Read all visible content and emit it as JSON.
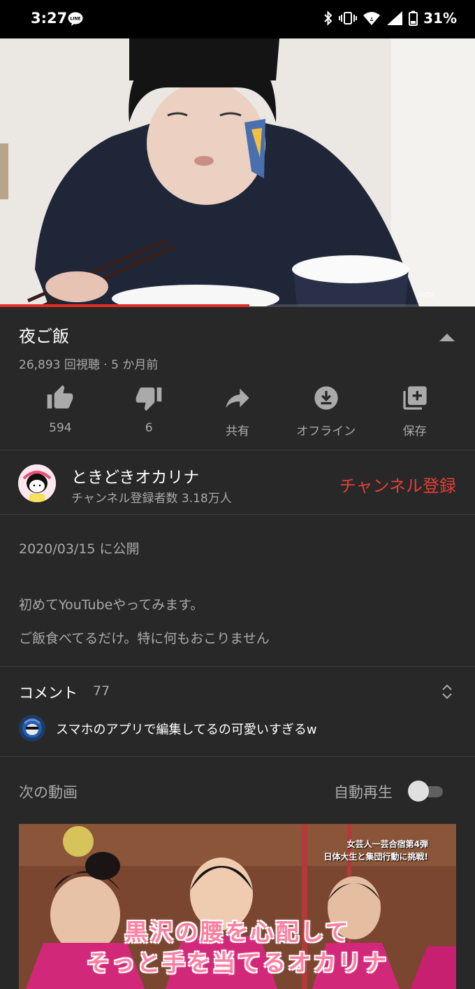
{
  "status_bar": {
    "time": "3:27",
    "battery": "31%",
    "icons": [
      "line-app-icon",
      "bluetooth-icon",
      "vibrate-icon",
      "wifi-icon",
      "signal-icon",
      "battery-icon"
    ]
  },
  "player": {
    "progress_fraction": 0.525
  },
  "video": {
    "title": "夜ご飯",
    "meta": "26,893 回視聴 · 5 か月前"
  },
  "actions": [
    {
      "icon": "thumbs-up-icon",
      "label": "594"
    },
    {
      "icon": "thumbs-down-icon",
      "label": "6"
    },
    {
      "icon": "share-icon",
      "label": "共有"
    },
    {
      "icon": "download-icon",
      "label": "オフライン"
    },
    {
      "icon": "add-to-playlist-icon",
      "label": "保存"
    }
  ],
  "channel": {
    "name": "ときどきオカリナ",
    "subscribers": "チャンネル登録者数 3.18万人",
    "subscribe_label": "チャンネル登録"
  },
  "description": {
    "published": "2020/03/15 に公開",
    "lines": [
      "初めてYouTubeやってみます。",
      "ご飯食べてるだけ。特に何もおこりません"
    ]
  },
  "comments": {
    "label": "コメント",
    "count": "77",
    "top_comment": "スマホのアプリで編集してるの可愛いすぎるw"
  },
  "up_next": {
    "label": "次の動画",
    "autoplay_label": "自動再生",
    "autoplay_on": false,
    "thumbnail": {
      "overlay_line1": "女芸人一芸合宿第4弾",
      "overlay_line2": "日体大生と集団行動に挑戦!",
      "caption_line1": "黒沢の腰を心配して",
      "caption_line2": "そっと手を当てるオカリナ"
    }
  },
  "colors": {
    "background": "#282828",
    "accent_red": "#e53e36",
    "progress_red": "#e52d27",
    "secondary_text": "#aaaaaa"
  }
}
